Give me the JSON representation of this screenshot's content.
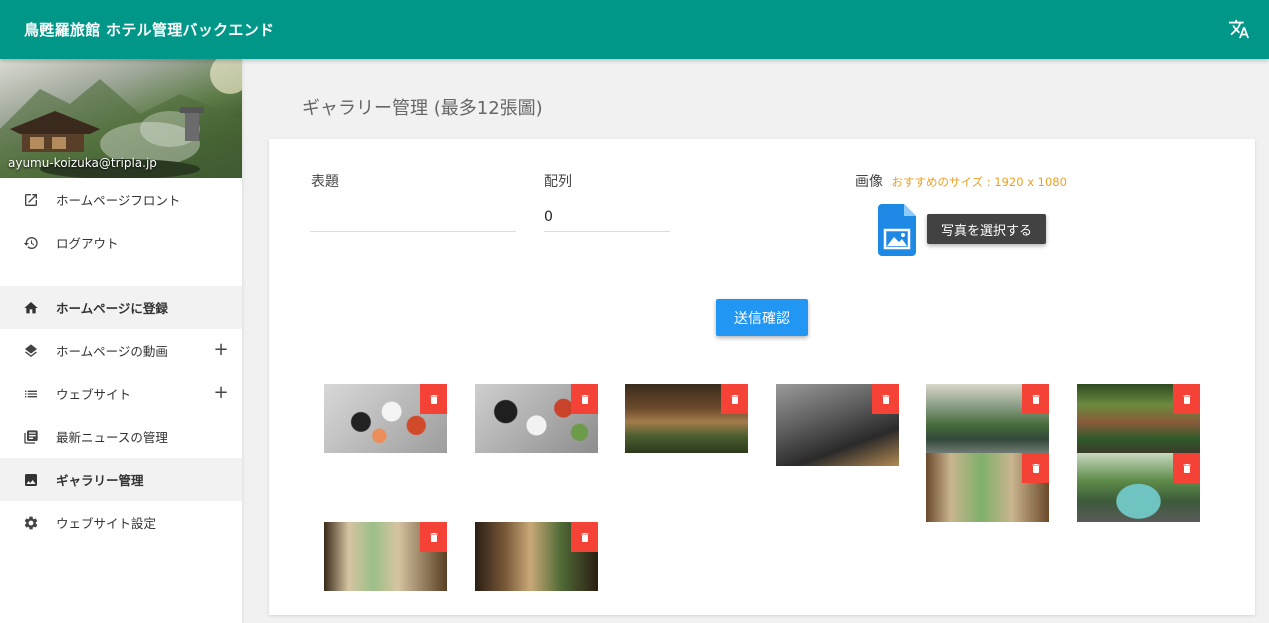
{
  "app": {
    "title": "鳥甦羅旅館 ホテル管理バックエンド",
    "language_icon": "translate-icon"
  },
  "user": {
    "email": "ayumu-koizuka@tripla.jp"
  },
  "sidebar": {
    "top_items": [
      {
        "label": "ホームページフロント",
        "icon": "open-in-new-icon"
      },
      {
        "label": "ログアウト",
        "icon": "history-icon"
      }
    ],
    "items": [
      {
        "label": "ホームページに登録",
        "icon": "home-icon",
        "active": true
      },
      {
        "label": "ホームページの動画",
        "icon": "layers-icon",
        "expandable": true
      },
      {
        "label": "ウェブサイト",
        "icon": "list-icon",
        "expandable": true
      },
      {
        "label": "最新ニュースの管理",
        "icon": "library-books-icon"
      },
      {
        "label": "ギャラリー管理",
        "icon": "image-icon",
        "active": true
      },
      {
        "label": "ウェブサイト設定",
        "icon": "settings-icon"
      }
    ]
  },
  "page": {
    "title": "ギャラリー管理 (最多12張圖)"
  },
  "form": {
    "title_label": "表題",
    "title_value": "",
    "order_label": "配列",
    "order_value": "0",
    "image_label": "画像",
    "image_hint": "おすすめのサイズ : 1920 x 1080",
    "select_button": "写真を選択する",
    "submit_button": "送信確認"
  },
  "colors": {
    "appbar": "#009688",
    "primary_button": "#2196f3",
    "delete": "#f44336",
    "hint": "#f0a020"
  }
}
